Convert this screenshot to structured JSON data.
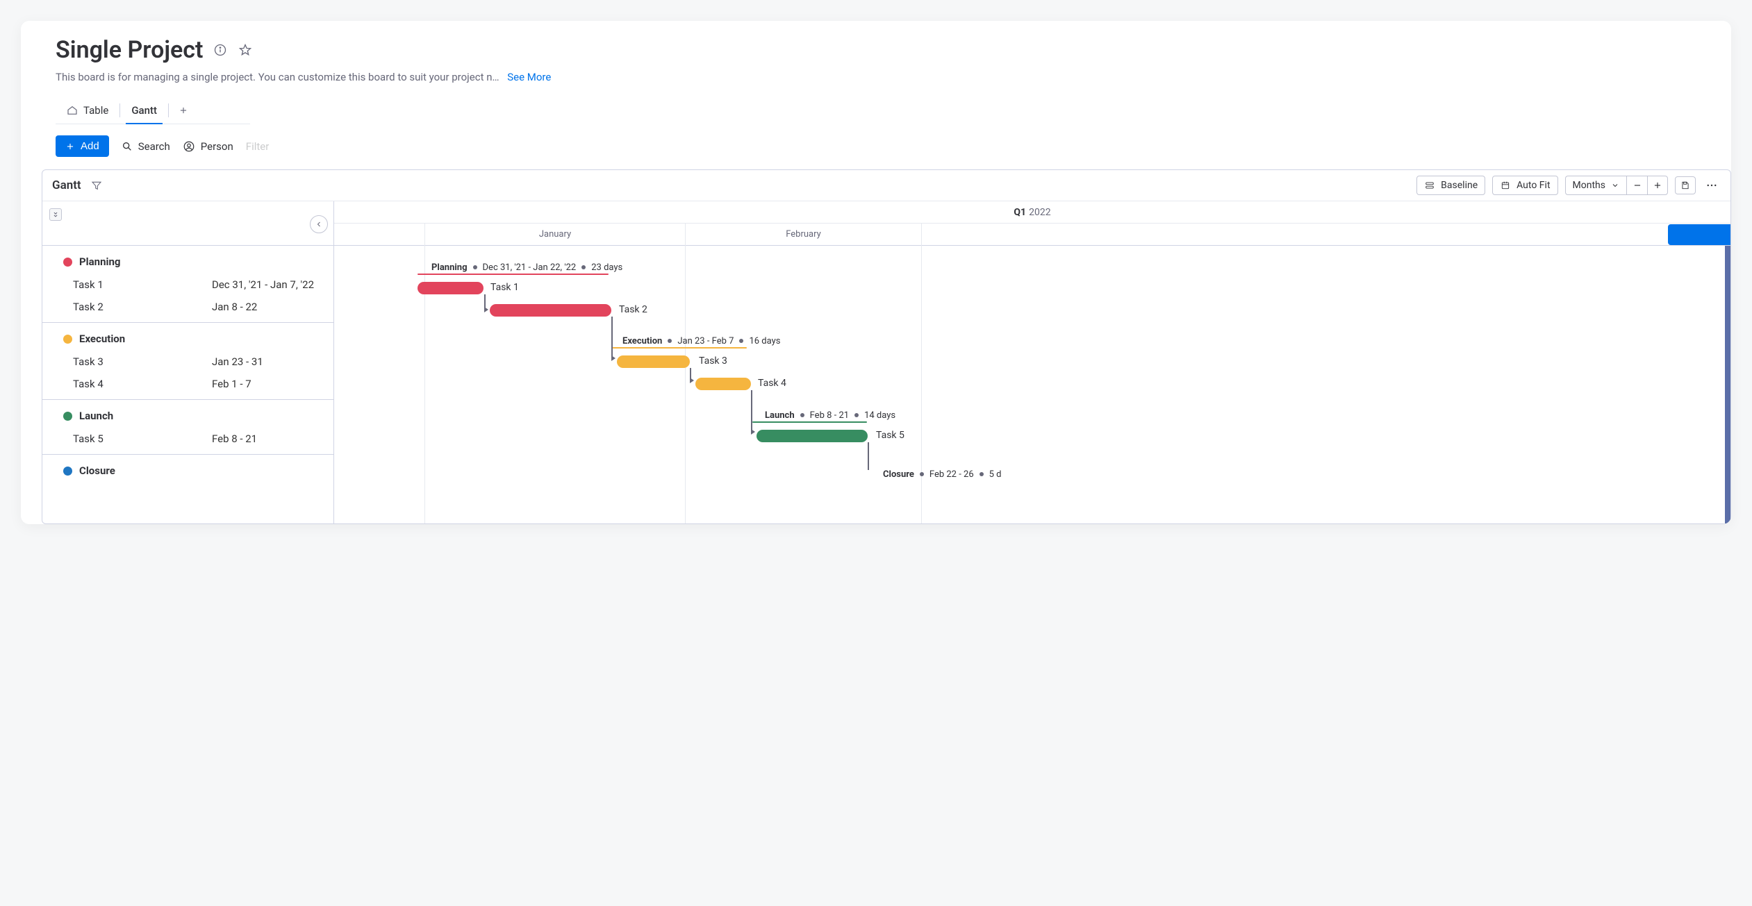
{
  "header": {
    "title": "Single Project",
    "description": "This board is for managing a single project. You can customize this board to suit your project n…",
    "see_more": "See More"
  },
  "tabs": [
    {
      "label": "Table",
      "icon": "home"
    },
    {
      "label": "Gantt",
      "icon": ""
    }
  ],
  "toolbar": {
    "add": "Add",
    "search": "Search",
    "person": "Person",
    "filter": "Filter"
  },
  "gantt": {
    "title": "Gantt",
    "baseline": "Baseline",
    "autofit": "Auto Fit",
    "range": "Months",
    "quarter_prefix": "Q1",
    "quarter_year": "2022",
    "months": [
      "January",
      "February"
    ]
  },
  "groups": [
    {
      "name": "Planning",
      "color": "#e2445c",
      "summary": "Dec 31, '21 - Jan 22, '22",
      "days": "23 days",
      "tasks": [
        {
          "name": "Task 1",
          "date": "Dec 31, '21 - Jan 7, '22"
        },
        {
          "name": "Task 2",
          "date": "Jan 8 - 22"
        }
      ]
    },
    {
      "name": "Execution",
      "color": "#f5b53f",
      "summary": "Jan 23 - Feb 7",
      "days": "16 days",
      "tasks": [
        {
          "name": "Task 3",
          "date": "Jan 23 - 31"
        },
        {
          "name": "Task 4",
          "date": "Feb 1 - 7"
        }
      ]
    },
    {
      "name": "Launch",
      "color": "#378d61",
      "summary": "Feb 8 - 21",
      "days": "14 days",
      "tasks": [
        {
          "name": "Task 5",
          "date": "Feb 8 - 21"
        }
      ]
    },
    {
      "name": "Closure",
      "color": "#1f76c2",
      "summary": "Feb 22 - 26",
      "days": "5 d",
      "tasks": []
    }
  ],
  "colors": {
    "planning": "#e2445c",
    "execution": "#f5b53f",
    "launch": "#378d61",
    "closure": "#1f76c2"
  },
  "chart_data": {
    "type": "gantt",
    "time_axis": {
      "start": "2021-12-31",
      "visible_months": [
        "January 2022",
        "February 2022"
      ],
      "quarter": "Q1 2022"
    },
    "rows": [
      {
        "group": "Planning",
        "summary": true,
        "start": "2021-12-31",
        "end": "2022-01-22",
        "duration_days": 23,
        "color": "#e2445c"
      },
      {
        "group": "Planning",
        "task": "Task 1",
        "start": "2021-12-31",
        "end": "2022-01-07",
        "color": "#e2445c"
      },
      {
        "group": "Planning",
        "task": "Task 2",
        "start": "2022-01-08",
        "end": "2022-01-22",
        "color": "#e2445c"
      },
      {
        "group": "Execution",
        "summary": true,
        "start": "2022-01-23",
        "end": "2022-02-07",
        "duration_days": 16,
        "color": "#f5b53f"
      },
      {
        "group": "Execution",
        "task": "Task 3",
        "start": "2022-01-23",
        "end": "2022-01-31",
        "color": "#f5b53f"
      },
      {
        "group": "Execution",
        "task": "Task 4",
        "start": "2022-02-01",
        "end": "2022-02-07",
        "color": "#f5b53f"
      },
      {
        "group": "Launch",
        "summary": true,
        "start": "2022-02-08",
        "end": "2022-02-21",
        "duration_days": 14,
        "color": "#378d61"
      },
      {
        "group": "Launch",
        "task": "Task 5",
        "start": "2022-02-08",
        "end": "2022-02-21",
        "color": "#378d61"
      },
      {
        "group": "Closure",
        "summary": true,
        "start": "2022-02-22",
        "end": "2022-02-26",
        "duration_days": 5,
        "color": "#1f76c2"
      }
    ],
    "dependencies": [
      [
        "Task 1",
        "Task 2"
      ],
      [
        "Task 2",
        "Task 3"
      ],
      [
        "Task 3",
        "Task 4"
      ],
      [
        "Task 4",
        "Task 5"
      ]
    ]
  }
}
